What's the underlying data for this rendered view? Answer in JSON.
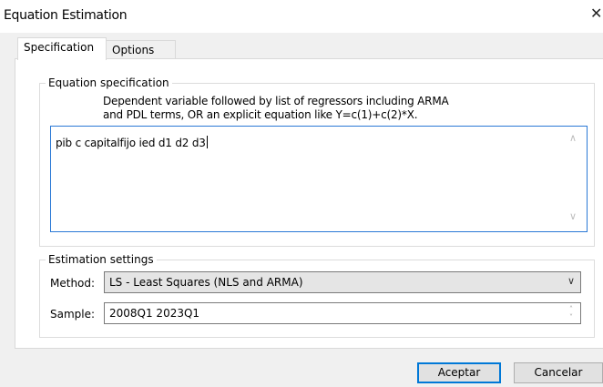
{
  "window": {
    "title": "Equation Estimation",
    "close_glyph": "✕"
  },
  "tabs": [
    {
      "label": "Specification",
      "active": true
    },
    {
      "label": "Options",
      "active": false
    }
  ],
  "equation_spec": {
    "group_title": "Equation specification",
    "hint_line1": "Dependent variable followed by list of regressors including ARMA",
    "hint_line2": "and PDL terms, OR an explicit equation like Y=c(1)+c(2)*X.",
    "text_value": "pib c capitalfijo ied d1 d2 d3"
  },
  "estimation": {
    "group_title": "Estimation settings",
    "method_label": "Method:",
    "method_value": "LS  -  Least Squares (NLS and ARMA)",
    "sample_label": "Sample:",
    "sample_value": "2008Q1 2023Q1"
  },
  "buttons": {
    "ok_label": "Aceptar",
    "cancel_label": "Cancelar"
  },
  "icons": {
    "scroll_up": "∧",
    "scroll_down": "∨",
    "dropdown": "∨",
    "spin_up": "˄",
    "spin_down": "˅"
  }
}
